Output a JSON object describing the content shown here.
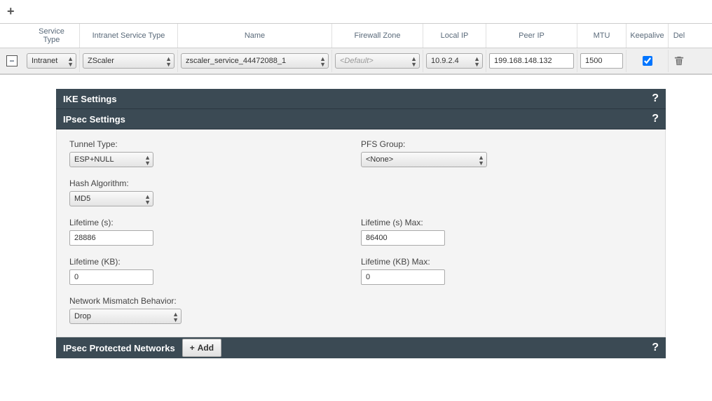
{
  "top_add_glyph": "+",
  "columns": {
    "service_type_l1": "Service",
    "service_type_l2": "Type",
    "intranet_service_type": "Intranet Service Type",
    "name": "Name",
    "firewall_zone": "Firewall Zone",
    "local_ip": "Local IP",
    "peer_ip": "Peer IP",
    "mtu": "MTU",
    "keepalive": "Keepalive",
    "del": "Del"
  },
  "row": {
    "collapse_glyph": "−",
    "service_type": "Intranet",
    "intranet_service_type": "ZScaler",
    "name": "zscaler_service_44472088_1",
    "firewall_zone": "<Default>",
    "local_ip": "10.9.2.4",
    "peer_ip": "199.168.148.132",
    "mtu": "1500",
    "keepalive_checked": true
  },
  "panels": {
    "ike_title": "IKE Settings",
    "ipsec_title": "IPsec Settings",
    "help_glyph": "?",
    "tunnel_type_label": "Tunnel Type:",
    "tunnel_type_value": "ESP+NULL",
    "pfs_group_label": "PFS Group:",
    "pfs_group_value": "<None>",
    "hash_label": "Hash Algorithm:",
    "hash_value": "MD5",
    "lifetime_s_label": "Lifetime (s):",
    "lifetime_s_value": "28886",
    "lifetime_s_max_label": "Lifetime (s) Max:",
    "lifetime_s_max_value": "86400",
    "lifetime_kb_label": "Lifetime (KB):",
    "lifetime_kb_value": "0",
    "lifetime_kb_max_label": "Lifetime (KB) Max:",
    "lifetime_kb_max_value": "0",
    "mismatch_label": "Network Mismatch Behavior:",
    "mismatch_value": "Drop",
    "protected_title": "IPsec Protected Networks",
    "add_plus": "+",
    "add_label": "Add"
  }
}
